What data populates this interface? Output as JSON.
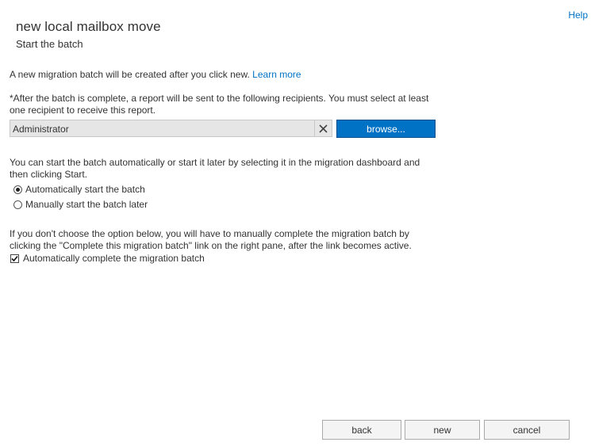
{
  "header": {
    "help_label": "Help",
    "title": "new local mailbox move",
    "subtitle": "Start the batch"
  },
  "intro": {
    "text": "A new migration batch will be created after you click new.",
    "learn_more": "Learn more"
  },
  "recipients": {
    "line1": "*After the batch is complete, a report will be sent to the following recipients. You must select at least",
    "line2": "one recipient to receive this report.",
    "value": "Administrator",
    "browse_label": "browse..."
  },
  "start": {
    "line1": "You can start the batch automatically or start it later by selecting it in the migration dashboard and",
    "line2": "then clicking Start.",
    "options": [
      {
        "label": "Automatically start the batch",
        "selected": true
      },
      {
        "label": "Manually start the batch later",
        "selected": false
      }
    ]
  },
  "complete": {
    "line1": "If you don't choose the option below, you will have to manually complete the migration batch by",
    "line2": "clicking the \"Complete this migration batch\" link on the right pane, after the link becomes active.",
    "checkbox_label": "Automatically complete the migration batch",
    "checked": true
  },
  "footer": {
    "back_label": "back",
    "new_label": "new",
    "cancel_label": "cancel"
  }
}
